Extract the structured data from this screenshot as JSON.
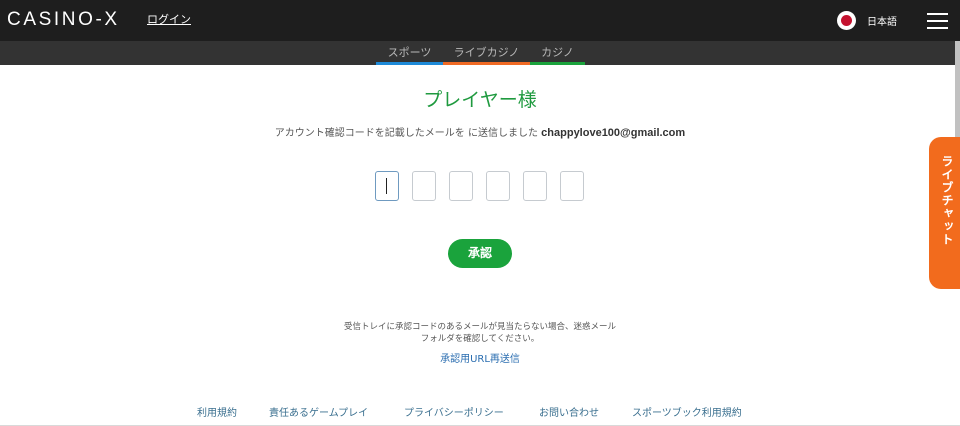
{
  "header": {
    "logo": "CASINO-X",
    "login_label": "ログイン",
    "language_label": "日本語"
  },
  "subnav": {
    "tabs": [
      {
        "label": "スポーツ",
        "accent": "#1e8ad8"
      },
      {
        "label": "ライブカジノ",
        "accent": "#f06a24"
      },
      {
        "label": "カジノ",
        "accent": "#1aa33c"
      }
    ]
  },
  "verify": {
    "title": "プレイヤー様",
    "message": "アカウント確認コードを記載したメールを に送信しました",
    "email": "chappylove100@gmail.com",
    "code_digits": [
      "",
      "",
      "",
      "",
      "",
      ""
    ],
    "approve_label": "承認",
    "hint": "受信トレイに承認コードのあるメールが見当たらない場合、迷惑メールフォルダを確認してください。",
    "resend_label": "承認用URL再送信"
  },
  "footer": {
    "links": [
      "利用規約",
      "責任あるゲームプレイ",
      "プライバシーポリシー",
      "お問い合わせ",
      "スポーツブック利用規約"
    ]
  },
  "chat": {
    "label": "ライブチャット"
  },
  "colors": {
    "brand_green": "#1aa33c",
    "chat_orange": "#f26b1d",
    "topbar": "#1e1e1e"
  }
}
